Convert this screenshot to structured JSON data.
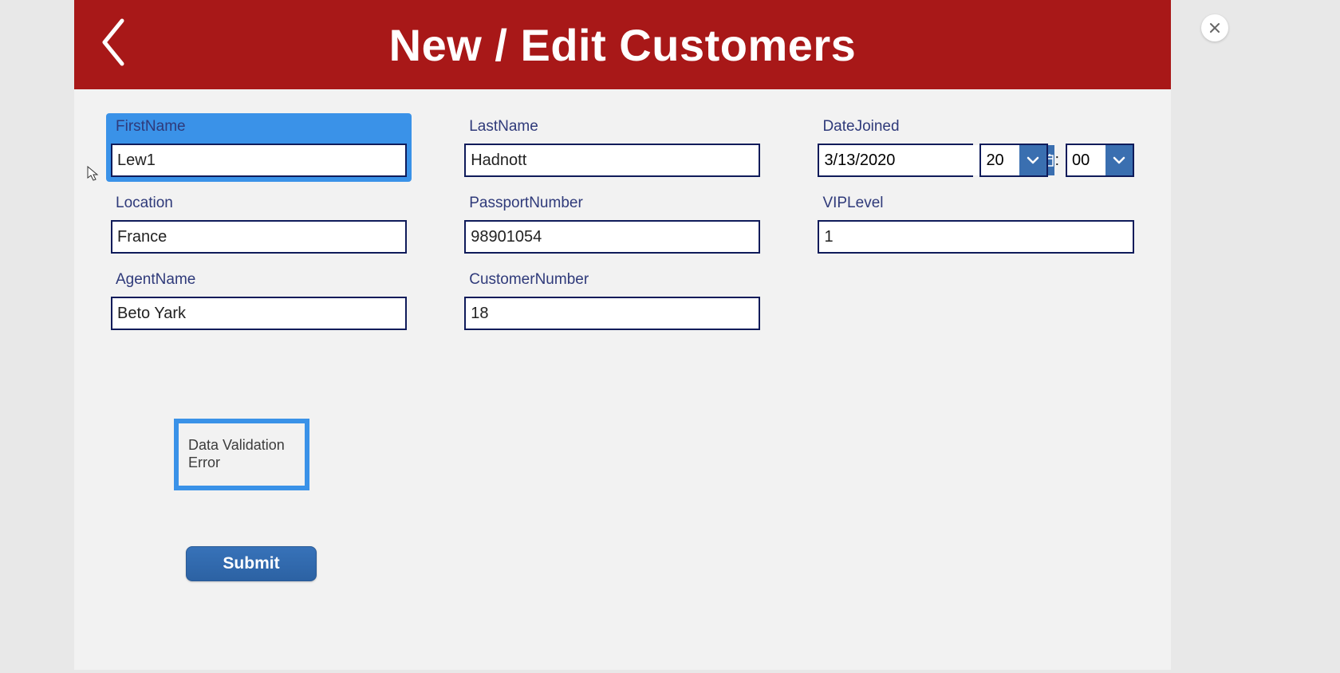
{
  "header": {
    "title": "New / Edit Customers"
  },
  "form": {
    "firstName": {
      "label": "FirstName",
      "value": "Lew1"
    },
    "lastName": {
      "label": "LastName",
      "value": "Hadnott"
    },
    "dateJoined": {
      "label": "DateJoined",
      "date": "3/13/2020",
      "hour": "20",
      "minute": "00",
      "colon": ":"
    },
    "location": {
      "label": "Location",
      "value": "France"
    },
    "passportNumber": {
      "label": "PassportNumber",
      "value": "98901054"
    },
    "vipLevel": {
      "label": "VIPLevel",
      "value": "1"
    },
    "agentName": {
      "label": "AgentName",
      "value": "Beto Yark"
    },
    "customerNumber": {
      "label": "CustomerNumber",
      "value": "18"
    }
  },
  "validation": {
    "message": "Data Validation Error"
  },
  "buttons": {
    "submit": "Submit"
  },
  "colors": {
    "headerBg": "#a81818",
    "highlight": "#3a92e8",
    "inputBorder": "#0f1b5a",
    "labelText": "#2f3a7a",
    "dropdownBg": "#3a6fb0",
    "submitBg": "#3772b9"
  }
}
